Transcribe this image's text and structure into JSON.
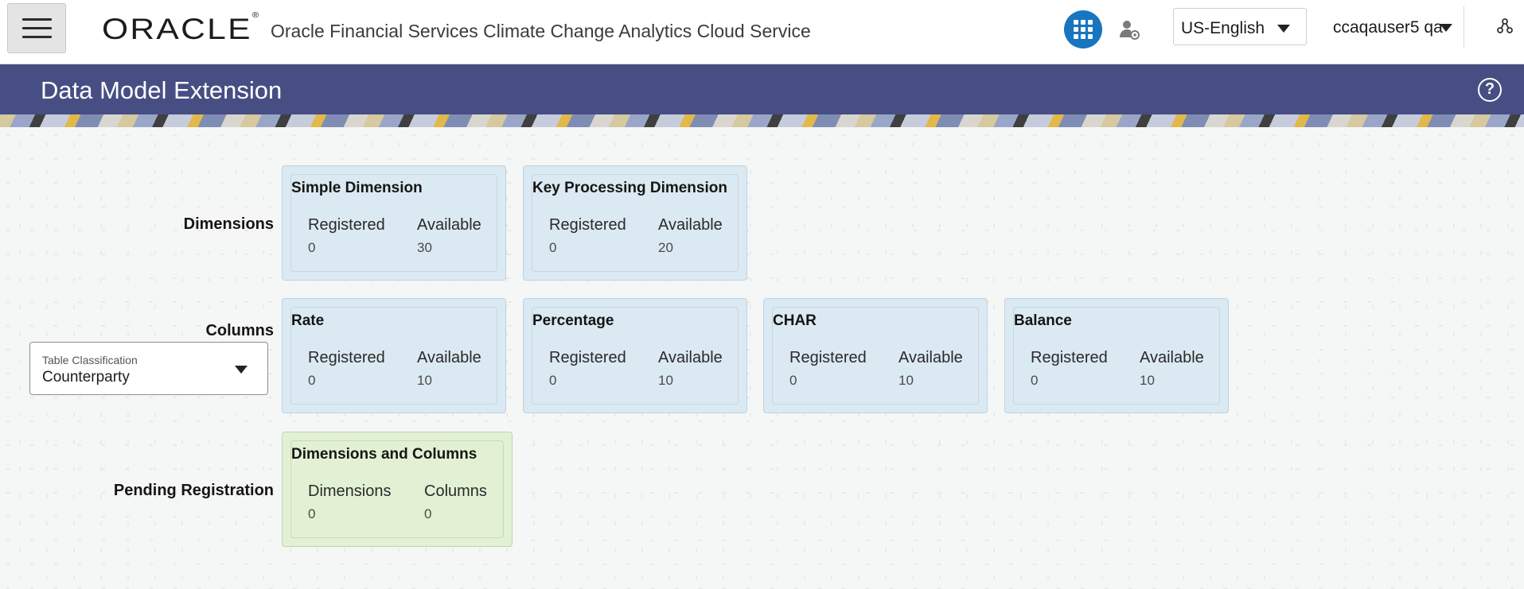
{
  "header": {
    "logo_text": "ORACLE",
    "logo_mark": "®",
    "app_title": "Oracle Financial Services Climate Change Analytics Cloud Service",
    "language": "US-English",
    "user": "ccaqauser5 qa",
    "icons": [
      "hamburger-menu-icon",
      "apps-grid-icon",
      "user-settings-icon",
      "hierarchy-icon",
      "help-icon"
    ]
  },
  "page": {
    "title": "Data Model Extension",
    "help_glyph": "?"
  },
  "table_classification": {
    "label": "Table Classification",
    "value": "Counterparty"
  },
  "rows": {
    "dimensions_label": "Dimensions",
    "columns_label": "Columns",
    "pending_label": "Pending Registration"
  },
  "tiles": {
    "simple_dimension": {
      "title": "Simple Dimension",
      "left_label": "Registered",
      "left_value": "0",
      "right_label": "Available",
      "right_value": "30"
    },
    "key_processing_dimension": {
      "title": "Key Processing Dimension",
      "left_label": "Registered",
      "left_value": "0",
      "right_label": "Available",
      "right_value": "20"
    },
    "rate": {
      "title": "Rate",
      "left_label": "Registered",
      "left_value": "0",
      "right_label": "Available",
      "right_value": "10"
    },
    "percentage": {
      "title": "Percentage",
      "left_label": "Registered",
      "left_value": "0",
      "right_label": "Available",
      "right_value": "10"
    },
    "char": {
      "title": "CHAR",
      "left_label": "Registered",
      "left_value": "0",
      "right_label": "Available",
      "right_value": "10"
    },
    "balance": {
      "title": "Balance",
      "left_label": "Registered",
      "left_value": "0",
      "right_label": "Available",
      "right_value": "10"
    },
    "dimensions_and_columns": {
      "title": "Dimensions and Columns",
      "left_label": "Dimensions",
      "left_value": "0",
      "right_label": "Columns",
      "right_value": "0"
    }
  },
  "colors": {
    "title_bar": "#474e83",
    "apps_button": "#1875c0",
    "tile_blue": "#dbe9f2",
    "tile_green": "#e2f1d3"
  }
}
